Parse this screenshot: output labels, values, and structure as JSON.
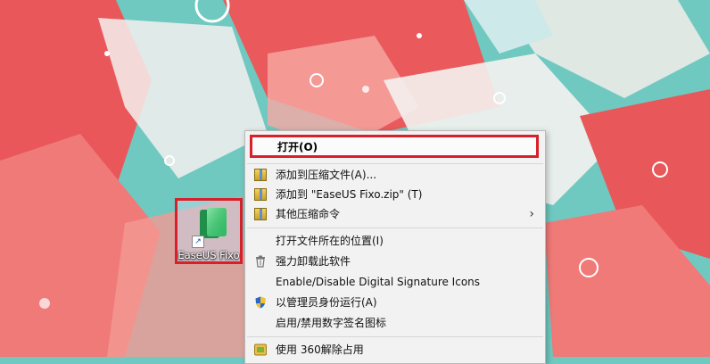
{
  "desktop": {
    "icon_label": "EaseUS Fixo"
  },
  "context_menu": {
    "items": [
      {
        "label": "打开(O)",
        "icon": "none"
      },
      {
        "label": "添加到压缩文件(A)...",
        "icon": "archive-icon"
      },
      {
        "label": "添加到 \"EaseUS Fixo.zip\" (T)",
        "icon": "archive-icon"
      },
      {
        "label": "其他压缩命令",
        "icon": "archive-icon",
        "submenu": true
      },
      {
        "label": "打开文件所在的位置(I)",
        "icon": "none"
      },
      {
        "label": "强力卸载此软件",
        "icon": "trash-icon"
      },
      {
        "label": "Enable/Disable Digital Signature Icons",
        "icon": "none"
      },
      {
        "label": "以管理员身份运行(A)",
        "icon": "uac-shield-icon"
      },
      {
        "label": "启用/禁用数字签名图标",
        "icon": "none"
      },
      {
        "label": "使用 360解除占用",
        "icon": "360-icon"
      }
    ]
  },
  "colors": {
    "highlight_border": "#d8202a",
    "menu_background": "#f2f2f2",
    "wallpaper_teal": "#6fc9c0",
    "wallpaper_red": "#e8575a"
  }
}
